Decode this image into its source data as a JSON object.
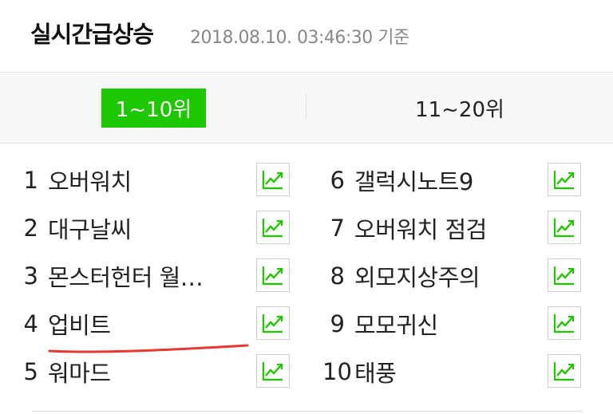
{
  "header": {
    "title": "실시간급상승",
    "timestamp": "2018.08.10. 03:46:30 기준"
  },
  "tabs": [
    {
      "label": "1~10위",
      "active": true
    },
    {
      "label": "11~20위",
      "active": false
    }
  ],
  "keywords_left": [
    {
      "rank": "1",
      "text": "오버워치"
    },
    {
      "rank": "2",
      "text": "대구날씨"
    },
    {
      "rank": "3",
      "text": "몬스터헌터 월…"
    },
    {
      "rank": "4",
      "text": "업비트"
    },
    {
      "rank": "5",
      "text": "워마드"
    }
  ],
  "keywords_right": [
    {
      "rank": "6",
      "text": "갤럭시노트9"
    },
    {
      "rank": "7",
      "text": "오버워치 점검"
    },
    {
      "rank": "8",
      "text": "외모지상주의"
    },
    {
      "rank": "9",
      "text": "모모귀신"
    },
    {
      "rank": "10",
      "text": "태풍"
    }
  ],
  "trend_icon": "trend-chart-icon",
  "colors": {
    "accent": "#1ec800",
    "annotation": "#e53935"
  }
}
